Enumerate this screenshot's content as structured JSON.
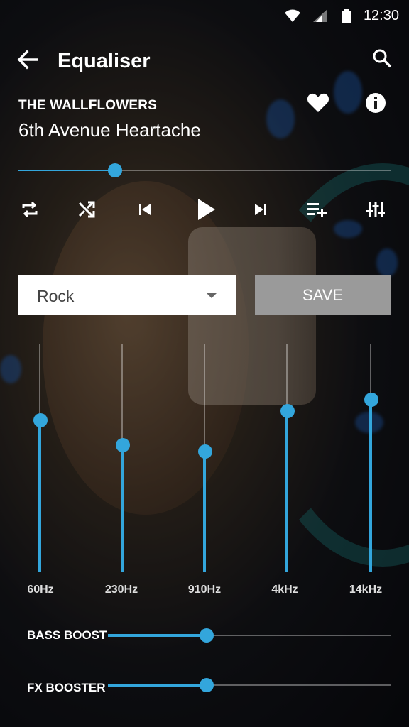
{
  "status": {
    "time": "12:30"
  },
  "appbar": {
    "title": "Equaliser"
  },
  "now_playing": {
    "artist": "THE WALLFLOWERS",
    "track": "6th Avenue Heartache",
    "progress": 0.26
  },
  "preset": {
    "value": "Rock"
  },
  "save_label": "SAVE",
  "bands": [
    {
      "label": "60Hz",
      "level": 0.67
    },
    {
      "label": "230Hz",
      "level": 0.56
    },
    {
      "label": "910Hz",
      "level": 0.53
    },
    {
      "label": "4kHz",
      "level": 0.71
    },
    {
      "label": "14kHz",
      "level": 0.76
    }
  ],
  "boost": {
    "bass_label": "BASS BOOST",
    "bass_level": 0.35,
    "fx_label": "FX BOOSTER",
    "fx_level": 0.35
  },
  "accent": "#33a6dc"
}
